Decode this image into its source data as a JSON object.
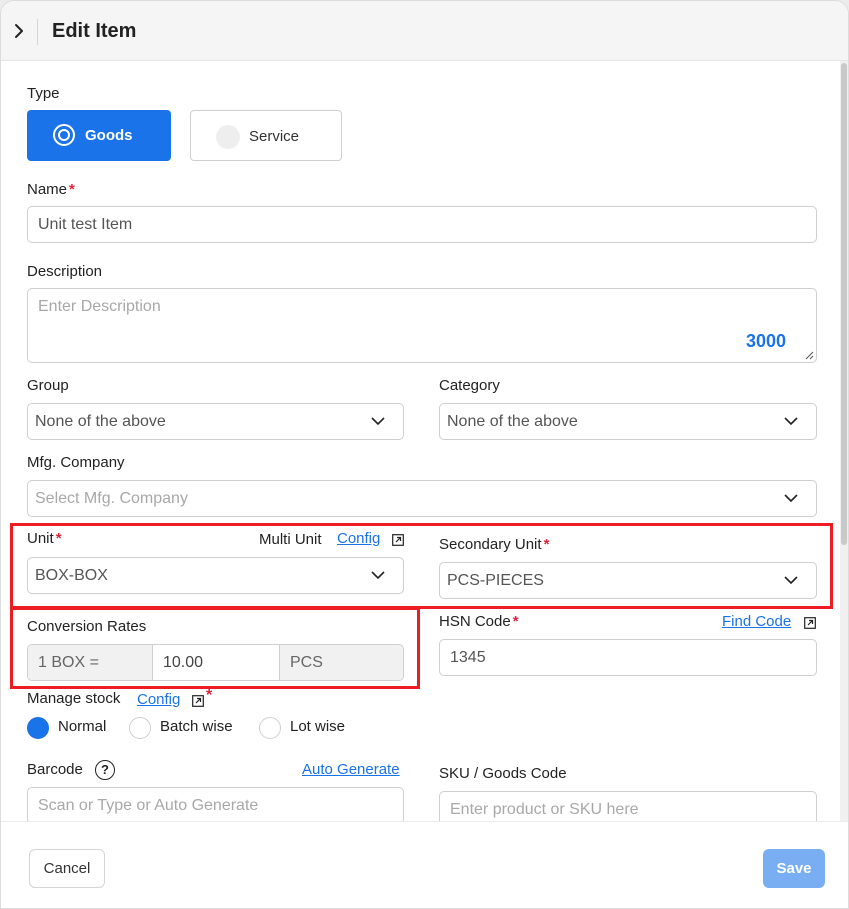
{
  "header": {
    "title": "Edit Item"
  },
  "type": {
    "label": "Type",
    "options": [
      {
        "label": "Goods",
        "selected": true
      },
      {
        "label": "Service",
        "selected": false
      }
    ]
  },
  "name": {
    "label": "Name",
    "value": "Unit test Item"
  },
  "description": {
    "label": "Description",
    "placeholder": "Enter Description",
    "char_count": "3000"
  },
  "group": {
    "label": "Group",
    "value": "None of the above"
  },
  "category": {
    "label": "Category",
    "value": "None of the above"
  },
  "mfg_company": {
    "label": "Mfg. Company",
    "placeholder": "Select Mfg. Company"
  },
  "unit": {
    "label": "Unit",
    "value": "BOX-BOX",
    "multi_unit_label": "Multi Unit",
    "config_link": "Config"
  },
  "secondary_unit": {
    "label": "Secondary Unit",
    "value": "PCS-PIECES"
  },
  "conversion": {
    "label": "Conversion Rates",
    "left": "1 BOX =",
    "rate": "10.00",
    "right": "PCS"
  },
  "hsn": {
    "label": "HSN Code",
    "find_link": "Find Code",
    "value": "1345"
  },
  "manage_stock": {
    "label": "Manage stock",
    "config_link": "Config",
    "options": [
      {
        "label": "Normal",
        "selected": true
      },
      {
        "label": "Batch wise",
        "selected": false
      },
      {
        "label": "Lot wise",
        "selected": false
      }
    ]
  },
  "barcode": {
    "label": "Barcode",
    "help_glyph": "?",
    "auto_link": "Auto Generate",
    "placeholder": "Scan or Type or Auto Generate"
  },
  "sku": {
    "label": "SKU / Goods Code",
    "placeholder": "Enter product or SKU here"
  },
  "footer": {
    "cancel": "Cancel",
    "save": "Save"
  },
  "required_mark": "*",
  "colors": {
    "accent": "#1a73e8",
    "highlight": "#ee1d23",
    "required": "#e0243a",
    "save_disabled": "#79aef3"
  }
}
